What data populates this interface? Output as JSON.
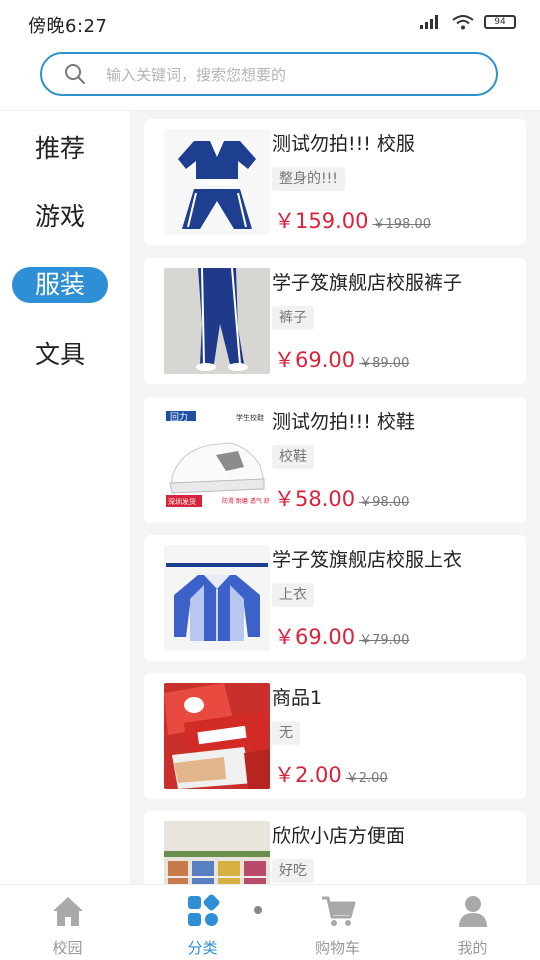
{
  "status_bar": {
    "time": "傍晚6:27",
    "battery": "94"
  },
  "search": {
    "placeholder": "输入关键词，搜索您想要的"
  },
  "sidebar": {
    "items": [
      {
        "label": "推荐",
        "active": false
      },
      {
        "label": "游戏",
        "active": false
      },
      {
        "label": "服装",
        "active": true
      },
      {
        "label": "文具",
        "active": false
      }
    ]
  },
  "products": [
    {
      "title": "测试勿拍!!! 校服",
      "tag": "整身的!!!",
      "price": "￥159.00",
      "original": "￥198.00"
    },
    {
      "title": "学子笈旗舰店校服裤子",
      "tag": "裤子",
      "price": "￥69.00",
      "original": "￥89.00"
    },
    {
      "title": "测试勿拍!!! 校鞋",
      "tag": "校鞋",
      "price": "￥58.00",
      "original": "￥98.00"
    },
    {
      "title": "学子笈旗舰店校服上衣",
      "tag": "上衣",
      "price": "￥69.00",
      "original": "￥79.00"
    },
    {
      "title": "商品1",
      "tag": "无",
      "price": "￥2.00",
      "original": "￥2.00"
    },
    {
      "title": "欣欣小店方便面",
      "tag": "好吃",
      "price": "",
      "original": ""
    }
  ],
  "thumb_text": {
    "shoe_brand": "回力",
    "shoe_caption": "学生校鞋",
    "shoe_badge": "深圳发货",
    "shoe_note": "防滑 耐磨 透气 舒适"
  },
  "bottom_nav": {
    "items": [
      {
        "label": "校园",
        "icon": "home-icon"
      },
      {
        "label": "分类",
        "icon": "category-icon"
      },
      {
        "label": "购物车",
        "icon": "cart-icon"
      },
      {
        "label": "我的",
        "icon": "user-icon"
      }
    ],
    "active_index": 1
  },
  "colors": {
    "accent": "#2f8fd6",
    "price": "#d9233a",
    "search_border": "#2f8fc9"
  }
}
